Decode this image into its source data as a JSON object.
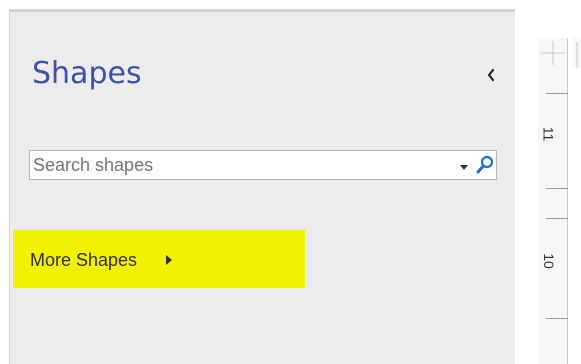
{
  "shapes_pane": {
    "title": "Shapes",
    "collapse_icon": "chevron-left-icon",
    "search": {
      "placeholder": "Search shapes",
      "value": "Search shapes",
      "dropdown_icon": "caret-down-icon",
      "search_icon": "magnifier-icon"
    },
    "more_shapes": {
      "label": "More Shapes",
      "arrow_icon": "caret-right-icon"
    }
  },
  "vertical_ruler": {
    "labels": [
      "11",
      "10"
    ]
  },
  "colors": {
    "title": "#4050a6",
    "highlight": "#f1f100",
    "search_icon": "#1e73c8",
    "pane_background": "#ececec"
  }
}
